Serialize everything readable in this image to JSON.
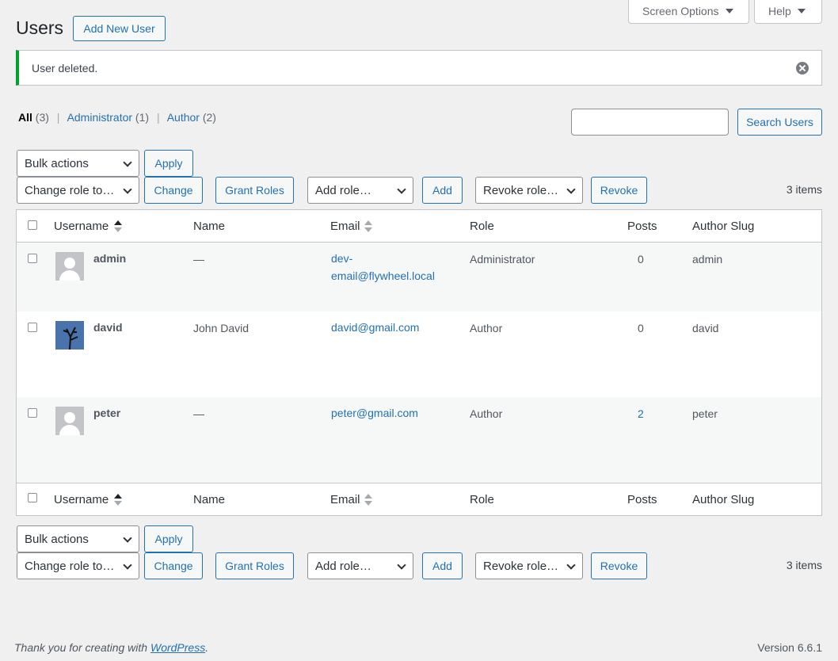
{
  "top": {
    "screen_options": "Screen Options",
    "help": "Help"
  },
  "page": {
    "title": "Users",
    "add_new": "Add New User"
  },
  "notice": {
    "text": "User deleted."
  },
  "filters": {
    "all": "All",
    "all_count": "(3)",
    "administrator": "Administrator",
    "administrator_count": "(1)",
    "author": "Author",
    "author_count": "(2)",
    "sep": "|"
  },
  "search": {
    "value": "",
    "button": "Search Users"
  },
  "actions": {
    "bulk": "Bulk actions",
    "apply": "Apply",
    "change_role": "Change role to…",
    "change": "Change",
    "grant_roles": "Grant Roles",
    "add_role": "Add role…",
    "add": "Add",
    "revoke_role": "Revoke role…",
    "revoke": "Revoke",
    "items": "3 items"
  },
  "columns": {
    "username": "Username",
    "name": "Name",
    "email": "Email",
    "role": "Role",
    "posts": "Posts",
    "slug": "Author Slug"
  },
  "users": [
    {
      "username": "admin",
      "name": "—",
      "email": "dev-email@flywheel.local",
      "email_line1": "dev-",
      "email_line2": "email@flywheel.local",
      "role": "Administrator",
      "posts": "0",
      "slug": "admin"
    },
    {
      "username": "david",
      "name": "John David",
      "email": "david@gmail.com",
      "role": "Author",
      "posts": "0",
      "slug": "david"
    },
    {
      "username": "peter",
      "name": "—",
      "email": "peter@gmail.com",
      "role": "Author",
      "posts": "2",
      "slug": "peter"
    }
  ],
  "footer": {
    "thanks_prefix": "Thank you for creating with ",
    "wordpress": "WordPress",
    "thanks_suffix": ".",
    "version": "Version 6.6.1"
  }
}
